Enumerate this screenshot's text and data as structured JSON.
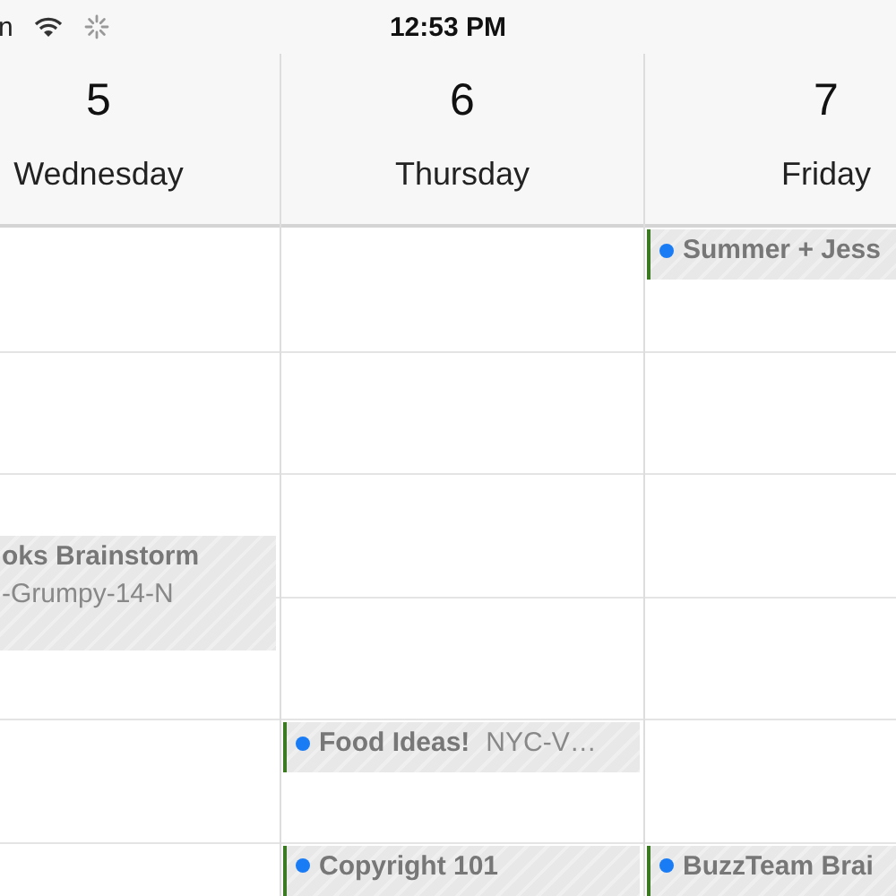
{
  "status_bar": {
    "carrier": "n",
    "time": "12:53 PM"
  },
  "days": [
    {
      "number": "5",
      "name": "Wednesday",
      "slots": [
        {
          "kind": "free"
        },
        {
          "kind": "free"
        },
        {
          "kind": "free"
        },
        {
          "kind": "free"
        },
        {
          "kind": "free"
        },
        {
          "kind": "event",
          "long": true,
          "title": "oks Brainstorm",
          "location": "-Grumpy-14-N"
        },
        {
          "kind": "free"
        },
        {
          "kind": "free"
        },
        {
          "kind": "free"
        },
        {
          "kind": "free"
        },
        {
          "kind": "free"
        }
      ]
    },
    {
      "number": "6",
      "name": "Thursday",
      "slots": [
        {
          "kind": "free"
        },
        {
          "kind": "free"
        },
        {
          "kind": "free"
        },
        {
          "kind": "free"
        },
        {
          "kind": "free"
        },
        {
          "kind": "free"
        },
        {
          "kind": "free"
        },
        {
          "kind": "free"
        },
        {
          "kind": "event",
          "long": false,
          "inline": true,
          "color": "#1a7cf5",
          "title": "Food Ideas!",
          "location": "NYC-V…"
        },
        {
          "kind": "free"
        },
        {
          "kind": "event",
          "color": "#1a7cf5",
          "title": "Copyright 101"
        }
      ]
    },
    {
      "number": "7",
      "name": "Friday",
      "slots": [
        {
          "kind": "event",
          "long": false,
          "color": "#1a7cf5",
          "title": "Summer + Jess"
        },
        {
          "kind": "free"
        },
        {
          "kind": "free"
        },
        {
          "kind": "free"
        },
        {
          "kind": "free"
        },
        {
          "kind": "free"
        },
        {
          "kind": "free"
        },
        {
          "kind": "free"
        },
        {
          "kind": "free"
        },
        {
          "kind": "free"
        },
        {
          "kind": "event",
          "color": "#1a7cf5",
          "title": "BuzzTeam Brai"
        }
      ]
    }
  ]
}
